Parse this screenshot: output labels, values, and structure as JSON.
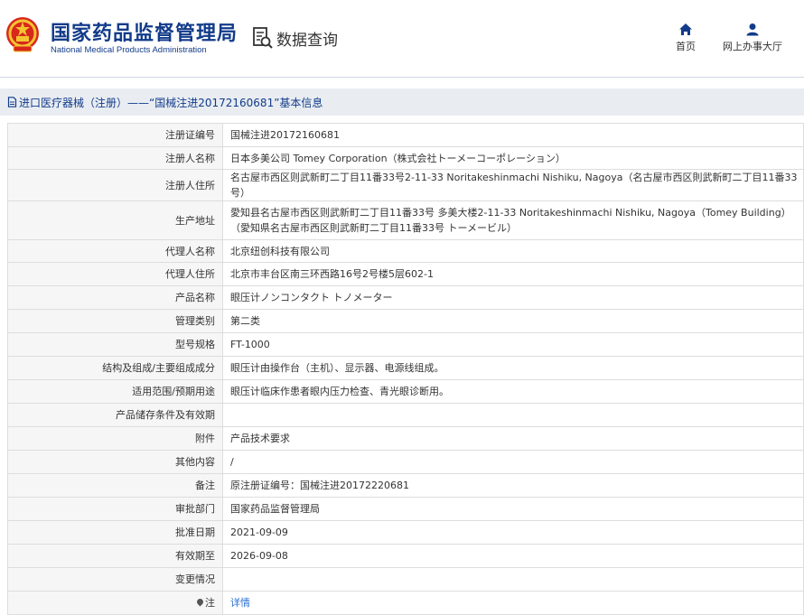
{
  "header": {
    "brand_cn": "国家药品监督管理局",
    "brand_en": "National Medical Products Administration",
    "data_query": "数据查询",
    "nav": {
      "home": "首页",
      "office": "网上办事大厅"
    }
  },
  "page": {
    "title": "进口医疗器械（注册）——“国械注进20172160681”基本信息"
  },
  "rows": [
    {
      "label": "注册证编号",
      "value": "国械注进20172160681"
    },
    {
      "label": "注册人名称",
      "value": "日本多美公司 Tomey Corporation（株式会社トーメーコーポレーション）"
    },
    {
      "label": "注册人住所",
      "value": "名古屋市西区则武新町二丁目11番33号2-11-33 Noritakeshinmachi Nishiku, Nagoya（名古屋市西区則武新町二丁目11番33号）"
    },
    {
      "label": "生产地址",
      "value": "愛知县名古屋市西区则武新町二丁目11番33号 多美大楼2-11-33 Noritakeshinmachi Nishiku, Nagoya（Tomey Building）（愛知県名古屋市西区則武新町二丁目11番33号 トーメービル）"
    },
    {
      "label": "代理人名称",
      "value": "北京纽创科技有限公司"
    },
    {
      "label": "代理人住所",
      "value": "北京市丰台区南三环西路16号2号楼5层602-1"
    },
    {
      "label": "产品名称",
      "value": "眼压计ノンコンタクト トノメーター"
    },
    {
      "label": "管理类别",
      "value": "第二类"
    },
    {
      "label": "型号规格",
      "value": "FT-1000"
    },
    {
      "label": "结构及组成/主要组成成分",
      "value": "眼压计由操作台（主机）、显示器、电源线组成。"
    },
    {
      "label": "适用范围/预期用途",
      "value": "眼压计临床作患者眼内压力检查、青光眼诊断用。"
    },
    {
      "label": "产品储存条件及有效期",
      "value": ""
    },
    {
      "label": "附件",
      "value": "产品技术要求"
    },
    {
      "label": "其他内容",
      "value": "/"
    },
    {
      "label": "备注",
      "value": "原注册证编号：国械注进20172220681"
    },
    {
      "label": "审批部门",
      "value": "国家药品监督管理局"
    },
    {
      "label": "批准日期",
      "value": "2021-09-09"
    },
    {
      "label": "有效期至",
      "value": "2026-09-08"
    },
    {
      "label": "变更情况",
      "value": ""
    }
  ],
  "note_row": {
    "label": "注",
    "link": "详情"
  },
  "colors": {
    "brand": "#123b8a",
    "link": "#2a6fd0",
    "label_bg": "#f6f6f6",
    "title_bar_bg": "#e9edf2"
  }
}
